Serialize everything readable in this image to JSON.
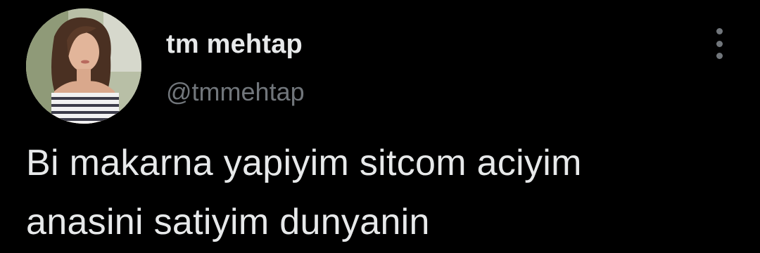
{
  "author": {
    "display_name": "tm mehtap",
    "handle": "@tmmehtap",
    "avatar": "profile-photo"
  },
  "menu": {
    "icon": "more-vertical-icon"
  },
  "tweet": {
    "lines": [
      "Bi makarna yapiyim sitcom aciyim",
      "anasini satiyim dunyanin"
    ]
  },
  "colors": {
    "background": "#000000",
    "primary_text": "#e7e9ea",
    "secondary_text": "#71767b"
  }
}
